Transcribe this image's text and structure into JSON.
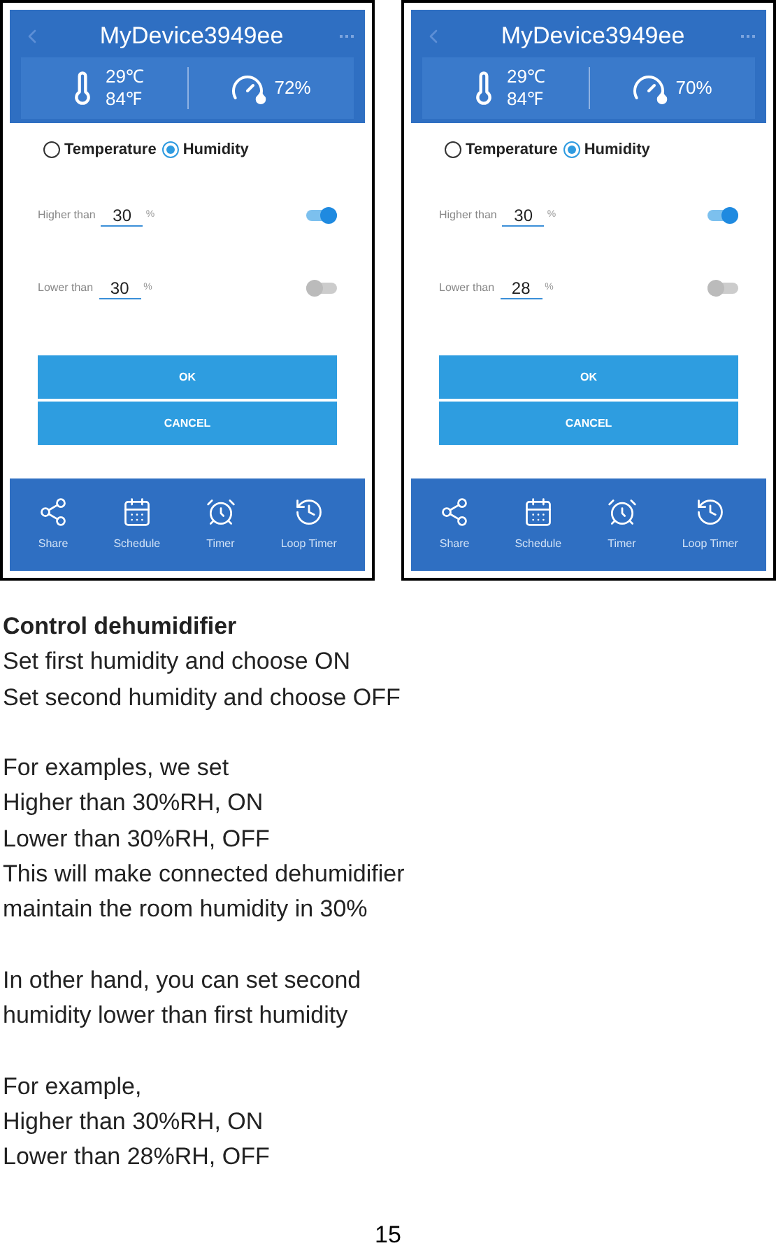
{
  "phones": [
    {
      "title": "MyDevice3949ee",
      "temp_c": "29℃",
      "temp_f": "84℉",
      "humidity": "72%",
      "modes": [
        {
          "label": "Temperature",
          "selected": false
        },
        {
          "label": "Humidity",
          "selected": true
        }
      ],
      "rules": [
        {
          "label": "Higher than",
          "value": "30",
          "unit": "%",
          "on": true
        },
        {
          "label": "Lower than",
          "value": "30",
          "unit": "%",
          "on": false
        }
      ],
      "buttons": [
        "OK",
        "CANCEL"
      ],
      "nav": [
        {
          "label": "Share",
          "kind": "share"
        },
        {
          "label": "Schedule",
          "kind": "schedule"
        },
        {
          "label": "Timer",
          "kind": "timer"
        },
        {
          "label": "Loop Timer",
          "kind": "loop"
        }
      ]
    },
    {
      "title": "MyDevice3949ee",
      "temp_c": "29℃",
      "temp_f": "84℉",
      "humidity": "70%",
      "modes": [
        {
          "label": "Temperature",
          "selected": false
        },
        {
          "label": "Humidity",
          "selected": true
        }
      ],
      "rules": [
        {
          "label": "Higher than",
          "value": "30",
          "unit": "%",
          "on": true
        },
        {
          "label": "Lower than",
          "value": "28",
          "unit": "%",
          "on": false
        }
      ],
      "buttons": [
        "OK",
        "CANCEL"
      ],
      "nav": [
        {
          "label": "Share",
          "kind": "share"
        },
        {
          "label": "Schedule",
          "kind": "schedule"
        },
        {
          "label": "Timer",
          "kind": "timer"
        },
        {
          "label": "Loop Timer",
          "kind": "loop"
        }
      ]
    }
  ],
  "heading": "Control dehumidifier",
  "paragraphs": [
    [
      "Set first humidity and choose ON",
      "Set second humidity and choose OFF"
    ],
    [
      "For examples, we set",
      "Higher than 30%RH, ON",
      "Lower than 30%RH,  OFF",
      "This will make connected dehumidifier",
      "maintain the room humidity in 30%"
    ],
    [
      "In other hand, you can set second",
      "humidity lower than first humidity"
    ],
    [
      "For example,",
      "Higher than 30%RH, ON",
      "Lower than  28%RH, OFF"
    ]
  ],
  "page_number": "15"
}
